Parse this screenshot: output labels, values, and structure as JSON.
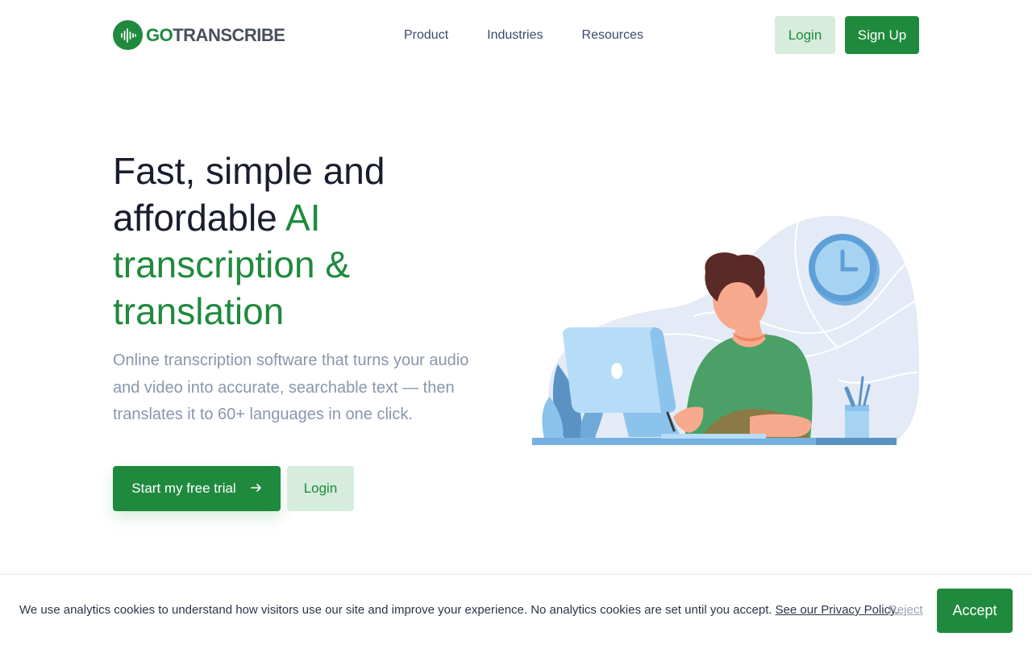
{
  "header": {
    "logo": {
      "go": "GO",
      "rest": "TRANSCRIBE",
      "icon": "soundwave-icon"
    },
    "nav": [
      "Product",
      "Industries",
      "Resources"
    ],
    "login_label": "Login",
    "signup_label": "Sign Up"
  },
  "hero": {
    "title_part1": "Fast, simple and affordable ",
    "title_accent": "AI transcription & translation",
    "subtitle": "Online transcription software that turns your audio and video into accurate, searchable text — then translates it to 60+ languages in one click.",
    "primary_cta": "Start my free trial",
    "primary_cta_icon": "arrow-right-icon",
    "secondary_cta": "Login"
  },
  "cookie_banner": {
    "text": "We use analytics cookies to understand how visitors use our site and improve your experience. No analytics cookies are set until you accept.",
    "link_label": "See our Privacy Policy.",
    "reject_label": "Reject",
    "accept_label": "Accept"
  },
  "colors": {
    "brand_green": "#1f8a3d",
    "soft_green": "#d6ecdc",
    "body_text": "#1a1d2e",
    "muted_text": "#8a96ae",
    "nav_text": "#3b4a6b"
  }
}
